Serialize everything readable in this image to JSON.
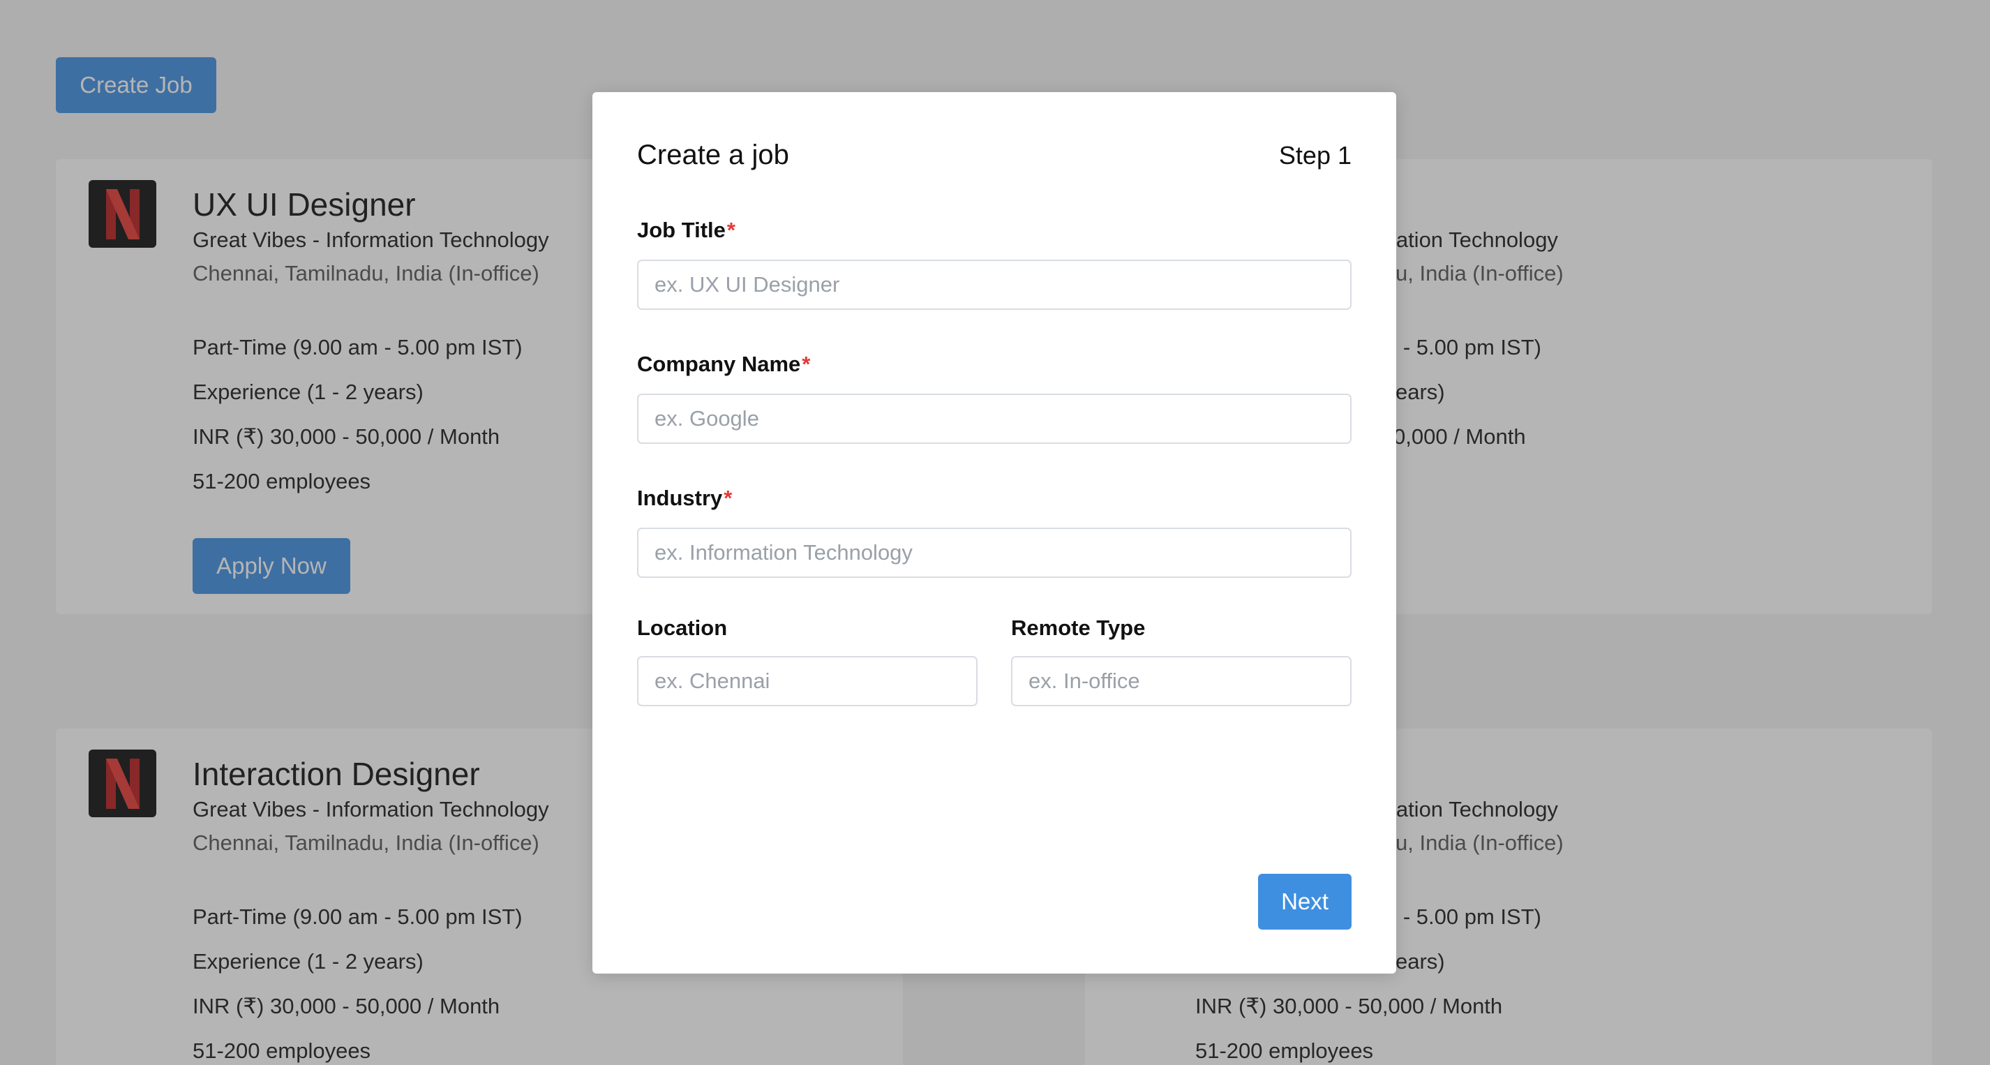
{
  "header": {
    "create_job_label": "Create Job"
  },
  "job_cards": [
    {
      "title": "UX UI Designer",
      "company_industry": "Great Vibes - Information Technology",
      "location": "Chennai, Tamilnadu, India (In-office)",
      "schedule": "Part-Time (9.00 am - 5.00 pm IST)",
      "experience": "Experience (1 - 2 years)",
      "salary": "INR (₹) 30,000 - 50,000 / Month",
      "company_size": "51-200 employees",
      "apply_label": "Apply Now"
    },
    {
      "title_visible": "",
      "company_industry_visible": "mation Technology",
      "location_visible": "u, India (In-office)",
      "schedule_visible": "n - 5.00 pm IST)",
      "experience_visible": "ears)",
      "salary_visible": "0,000 / Month"
    },
    {
      "title": "Interaction Designer",
      "company_industry": "Great Vibes - Information Technology",
      "location": "Chennai, Tamilnadu, India (In-office)",
      "schedule": "Part-Time (9.00 am - 5.00 pm IST)",
      "experience": "Experience (1 - 2 years)",
      "salary": "INR (₹) 30,000 - 50,000 / Month",
      "company_size": "51-200 employees"
    },
    {
      "company_industry_visible": "mation Technology",
      "location_visible": "u, India (In-office)",
      "schedule_visible": "n - 5.00 pm IST)",
      "experience_visible": "ears)",
      "salary": "INR (₹) 30,000 - 50,000 / Month",
      "company_size": "51-200 employees"
    }
  ],
  "modal": {
    "title": "Create a job",
    "step": "Step 1",
    "required_mark": "*",
    "fields": {
      "job_title": {
        "label": "Job Title",
        "placeholder": "ex. UX UI Designer",
        "value": ""
      },
      "company_name": {
        "label": "Company Name",
        "placeholder": "ex. Google",
        "value": ""
      },
      "industry": {
        "label": "Industry",
        "placeholder": "ex. Information Technology",
        "value": ""
      },
      "location": {
        "label": "Location",
        "placeholder": "ex. Chennai",
        "value": ""
      },
      "remote_type": {
        "label": "Remote Type",
        "placeholder": "ex. In-office",
        "value": ""
      }
    },
    "next_label": "Next"
  },
  "colors": {
    "primary": "#3f8fe0",
    "required": "#e53935",
    "overlay": "rgba(60,60,60,0.38)",
    "logo_bg": "#0f0f0f",
    "logo_letter": "#c62828"
  },
  "icons": {
    "company_logo": "netflix-n-logo-icon"
  }
}
